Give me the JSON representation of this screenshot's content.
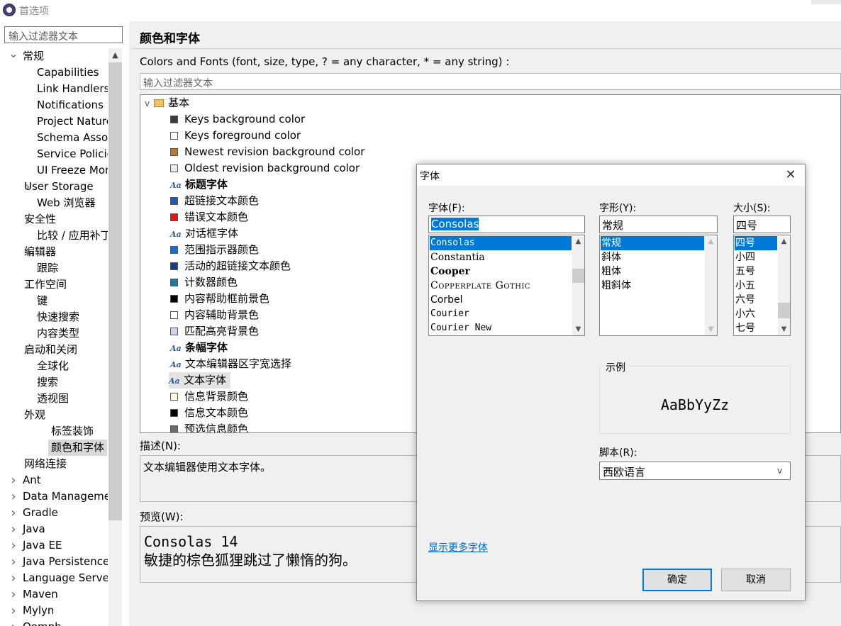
{
  "window": {
    "title": "首选项"
  },
  "left": {
    "filter_placeholder": "输入过滤器文本",
    "tree": [
      {
        "label": "常规",
        "arrow": "v",
        "indent": 0
      },
      {
        "label": "Capabilities",
        "arrow": "",
        "indent": 2
      },
      {
        "label": "Link Handlers",
        "arrow": "",
        "indent": 2
      },
      {
        "label": "Notifications",
        "arrow": "",
        "indent": 2
      },
      {
        "label": "Project Natures",
        "arrow": "",
        "indent": 2
      },
      {
        "label": "Schema Associations",
        "arrow": "",
        "indent": 2
      },
      {
        "label": "Service Policies",
        "arrow": "",
        "indent": 2
      },
      {
        "label": "UI Freeze Monitoring",
        "arrow": "",
        "indent": 2
      },
      {
        "label": "User Storage",
        "arrow": ">",
        "indent": 1
      },
      {
        "label": "Web 浏览器",
        "arrow": "",
        "indent": 2
      },
      {
        "label": "安全性",
        "arrow": ">",
        "indent": 1
      },
      {
        "label": "比较 / 应用补丁",
        "arrow": "",
        "indent": 2
      },
      {
        "label": "编辑器",
        "arrow": ">",
        "indent": 1
      },
      {
        "label": "跟踪",
        "arrow": "",
        "indent": 2
      },
      {
        "label": "工作空间",
        "arrow": ">",
        "indent": 1
      },
      {
        "label": "键",
        "arrow": "",
        "indent": 2
      },
      {
        "label": "快速搜索",
        "arrow": "",
        "indent": 2
      },
      {
        "label": "内容类型",
        "arrow": "",
        "indent": 2
      },
      {
        "label": "启动和关闭",
        "arrow": ">",
        "indent": 1
      },
      {
        "label": "全球化",
        "arrow": "",
        "indent": 2
      },
      {
        "label": "搜索",
        "arrow": "",
        "indent": 2
      },
      {
        "label": "透视图",
        "arrow": "",
        "indent": 2
      },
      {
        "label": "外观",
        "arrow": "v",
        "indent": 1
      },
      {
        "label": "标签装饰",
        "arrow": "",
        "indent": 3
      },
      {
        "label": "颜色和字体",
        "arrow": "",
        "indent": 3,
        "selected": true
      },
      {
        "label": "网络连接",
        "arrow": ">",
        "indent": 1
      },
      {
        "label": "Ant",
        "arrow": ">",
        "indent": 0
      },
      {
        "label": "Data Management",
        "arrow": ">",
        "indent": 0
      },
      {
        "label": "Gradle",
        "arrow": ">",
        "indent": 0
      },
      {
        "label": "Java",
        "arrow": ">",
        "indent": 0
      },
      {
        "label": "Java EE",
        "arrow": ">",
        "indent": 0
      },
      {
        "label": "Java Persistence",
        "arrow": ">",
        "indent": 0
      },
      {
        "label": "Language Servers",
        "arrow": ">",
        "indent": 0
      },
      {
        "label": "Maven",
        "arrow": ">",
        "indent": 0
      },
      {
        "label": "Mylyn",
        "arrow": ">",
        "indent": 0
      },
      {
        "label": "Oomph",
        "arrow": ">",
        "indent": 0
      }
    ]
  },
  "main": {
    "title": "颜色和字体",
    "cf_label": "Colors and Fonts (font, size, type, ? = any character, * = any string) :",
    "filter_placeholder": "输入过滤器文本",
    "root_label": "基本",
    "items": [
      {
        "label": "Keys background color",
        "kind": "color",
        "color": "#3c3c3c"
      },
      {
        "label": "Keys foreground color",
        "kind": "color",
        "color": "#ffffff"
      },
      {
        "label": "Newest revision background color",
        "kind": "color",
        "color": "#b77c3d"
      },
      {
        "label": "Oldest revision background color",
        "kind": "color",
        "color": "#f2ebe0"
      },
      {
        "label": "标题字体",
        "kind": "font",
        "bold": true
      },
      {
        "label": "超链接文本颜色",
        "kind": "color",
        "color": "#0f5ec9"
      },
      {
        "label": "错误文本颜色",
        "kind": "color",
        "color": "#e31515"
      },
      {
        "label": "对话框字体",
        "kind": "font"
      },
      {
        "label": "范围指示器颜色",
        "kind": "color",
        "color": "#1a6fd0"
      },
      {
        "label": "活动的超链接文本颜色",
        "kind": "color",
        "color": "#173e87"
      },
      {
        "label": "计数器颜色",
        "kind": "color",
        "color": "#1b7aa0"
      },
      {
        "label": "内容帮助框前景色",
        "kind": "color",
        "color": "#000000"
      },
      {
        "label": "内容辅助背景色",
        "kind": "color",
        "color": "#ffffff"
      },
      {
        "label": "匹配高亮背景色",
        "kind": "color",
        "color": "#d4d2f2"
      },
      {
        "label": "条幅字体",
        "kind": "font",
        "bold": true
      },
      {
        "label": "文本编辑器区字宽选择",
        "kind": "font"
      },
      {
        "label": "文本字体",
        "kind": "font",
        "selected": true
      },
      {
        "label": "信息背景颜色",
        "kind": "color",
        "color": "#fffbe0"
      },
      {
        "label": "信息文本颜色",
        "kind": "color",
        "color": "#000000"
      },
      {
        "label": "预选信息颜色",
        "kind": "color",
        "color": "#6e6e6e"
      }
    ],
    "desc_label": "描述(N):",
    "desc_text": "文本编辑器使用文本字体。",
    "preview_label": "预览(W):",
    "preview_line1": "Consolas 14",
    "preview_line2": "敏捷的棕色狐狸跳过了懒惰的狗。"
  },
  "dialog": {
    "title": "字体",
    "font_label": "字体(F):",
    "font_value": "Consolas",
    "font_list": [
      "Consolas",
      "Constantia",
      "Cooper",
      "Copperplate Gothic",
      "Corbel",
      "Courier",
      "Courier New"
    ],
    "style_label": "字形(Y):",
    "style_value": "常规",
    "style_list": [
      "常规",
      "斜体",
      "粗体",
      "粗斜体"
    ],
    "size_label": "大小(S):",
    "size_value": "四号",
    "size_list": [
      "四号",
      "小四",
      "五号",
      "小五",
      "六号",
      "小六",
      "七号"
    ],
    "sample_label": "示例",
    "sample_text": "AaBbYyZz",
    "script_label": "脚本(R):",
    "script_value": "西欧语言",
    "more_fonts": "显示更多字体",
    "ok": "确定",
    "cancel": "取消"
  }
}
